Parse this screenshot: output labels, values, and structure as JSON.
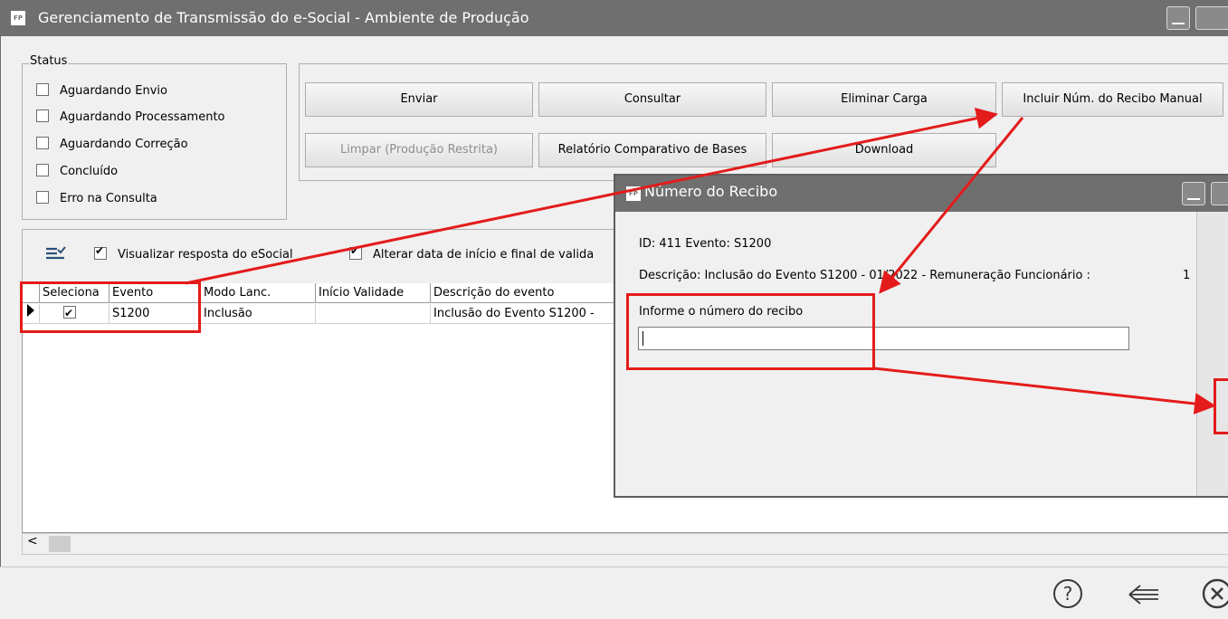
{
  "app_title": "Gerenciamento de Transmissão do e-Social - Ambiente de Produção",
  "logo_text": "FP",
  "status": {
    "legend": "Status",
    "items": [
      {
        "label": "Aguardando Envio",
        "checked": false
      },
      {
        "label": "Aguardando Processamento",
        "checked": false
      },
      {
        "label": "Aguardando Correção",
        "checked": false
      },
      {
        "label": "Concluído",
        "checked": false
      },
      {
        "label": "Erro na Consulta",
        "checked": false
      }
    ]
  },
  "buttons": {
    "enviar": "Enviar",
    "consultar": "Consultar",
    "eliminar_carga": "Eliminar Carga",
    "incluir_recibo": "Incluir Núm. do Recibo Manual",
    "limpar": "Limpar (Produção Restrita)",
    "relatorio": "Relatório Comparativo de Bases",
    "download": "Download"
  },
  "options": {
    "visualizar_resposta": "Visualizar resposta do eSocial",
    "alterar_data": "Alterar data de início e final de valida"
  },
  "grid": {
    "columns": [
      "Seleciona",
      "Evento",
      "Modo Lanc.",
      "Início Validade",
      "Descrição do evento"
    ],
    "rows": [
      {
        "selected": true,
        "evento": "S1200",
        "modo": "Inclusão",
        "inicio": "",
        "descricao": "Inclusão do Evento S1200 -"
      }
    ]
  },
  "scroll_left": "<",
  "footer_icons": [
    "help-icon",
    "back-arrow-icon",
    "close-icon"
  ],
  "dialog": {
    "title": "Número do Recibo",
    "id_line": "ID: 411 Evento: S1200",
    "descricao_line": "Descrição: Inclusão do Evento S1200 - 01/2022 - Remuneração Funcionário :",
    "descricao_suffix": "1",
    "field_label": "Informe o número do recibo",
    "field_value": ""
  },
  "colors": {
    "titlebar": "#6f6f6f",
    "annotation_red": "#e41b1b",
    "window_bg": "#f0f0f0"
  }
}
